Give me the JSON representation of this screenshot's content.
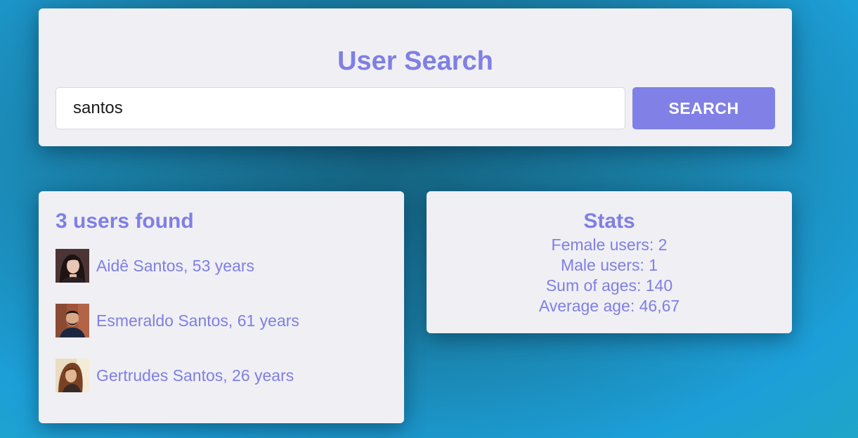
{
  "search": {
    "title": "User Search",
    "query": "santos",
    "button_label": "SEARCH"
  },
  "results": {
    "title": "3 users found",
    "users": [
      {
        "label": "Aidê Santos, 53 years",
        "avatar": "woman-avatar"
      },
      {
        "label": "Esmeraldo Santos, 61 years",
        "avatar": "man-avatar"
      },
      {
        "label": "Gertrudes Santos, 26 years",
        "avatar": "woman-avatar"
      }
    ]
  },
  "stats": {
    "title": "Stats",
    "female": "Female users: 2",
    "male": "Male users: 1",
    "sum_ages": "Sum of ages: 140",
    "average_age": "Average age: 46,67"
  },
  "colors": {
    "accent": "#7f7fe4",
    "button": "#8080e6",
    "card": "#f0eff4",
    "background": "#1c9fd8"
  }
}
